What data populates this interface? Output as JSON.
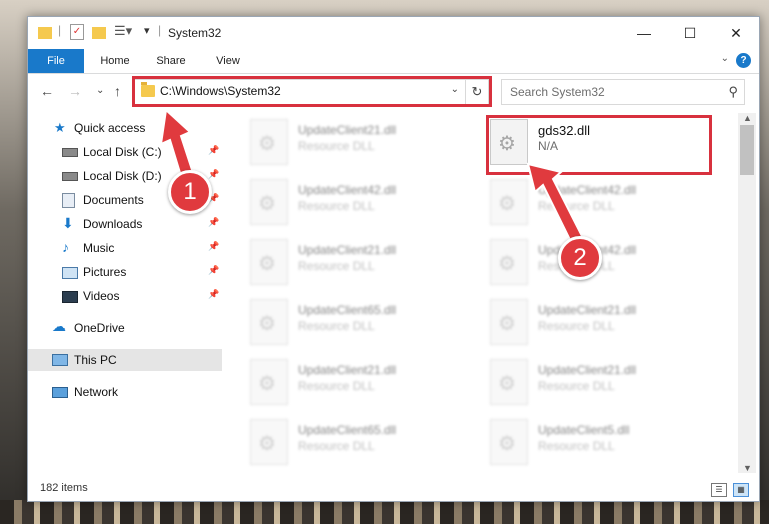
{
  "window": {
    "title": "System32",
    "buttons": {
      "minimize": "—",
      "maximize": "☐",
      "close": "✕"
    }
  },
  "ribbon": {
    "tabs": [
      "File",
      "Home",
      "Share",
      "View"
    ],
    "help": "?",
    "expand": "⌄"
  },
  "nav": {
    "back": "←",
    "forward": "→",
    "recent": "⌄",
    "up": "↑",
    "address": "C:\\Windows\\System32",
    "refresh": "↻",
    "search_placeholder": "Search System32",
    "search_icon": "⚲"
  },
  "sidebar": {
    "items": [
      {
        "label": "Quick access",
        "icon": "star-icon",
        "pinned": false
      },
      {
        "label": "Local Disk (C:)",
        "icon": "drive-icon",
        "pinned": true
      },
      {
        "label": "Local Disk (D:)",
        "icon": "drive-icon",
        "pinned": true
      },
      {
        "label": "Documents",
        "icon": "documents-icon",
        "pinned": true
      },
      {
        "label": "Downloads",
        "icon": "download-icon",
        "pinned": true
      },
      {
        "label": "Music",
        "icon": "music-icon",
        "pinned": true
      },
      {
        "label": "Pictures",
        "icon": "pictures-icon",
        "pinned": true
      },
      {
        "label": "Videos",
        "icon": "videos-icon",
        "pinned": true
      },
      {
        "label": "OneDrive",
        "icon": "cloud-icon",
        "pinned": false
      },
      {
        "label": "This PC",
        "icon": "computer-icon",
        "pinned": false,
        "selected": true
      },
      {
        "label": "Network",
        "icon": "network-icon",
        "pinned": false
      }
    ],
    "pin_glyph": "📌"
  },
  "files": [
    {
      "name": "UpdateClient21.dll",
      "type": "Resource DLL"
    },
    {
      "name": "gds32.dll",
      "type": "N/A",
      "highlighted": true
    },
    {
      "name": "UpdateClient42.dll",
      "type": "Resource DLL"
    },
    {
      "name": "UpdateClient42.dll",
      "type": "Resource DLL"
    },
    {
      "name": "UpdateClient21.dll",
      "type": "Resource DLL"
    },
    {
      "name": "UpdateClient42.dll",
      "type": "Resource DLL"
    },
    {
      "name": "UpdateClient65.dll",
      "type": "Resource DLL"
    },
    {
      "name": "UpdateClient21.dll",
      "type": "Resource DLL"
    },
    {
      "name": "UpdateClient21.dll",
      "type": "Resource DLL"
    },
    {
      "name": "UpdateClient21.dll",
      "type": "Resource DLL"
    },
    {
      "name": "UpdateClient65.dll",
      "type": "Resource DLL"
    },
    {
      "name": "UpdateClient5.dll",
      "type": "Resource DLL"
    }
  ],
  "status": {
    "item_count": "182 items"
  },
  "callouts": [
    "1",
    "2"
  ],
  "colors": {
    "accent": "#1979ca",
    "callout": "#e03a3e",
    "highlight_box": "#d8313e"
  }
}
